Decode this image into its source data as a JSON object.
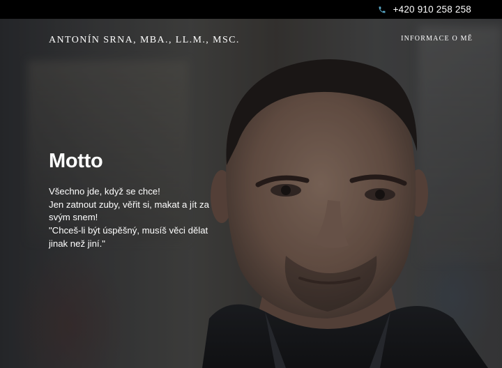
{
  "topbar": {
    "phone_icon": "phone-icon",
    "phone": "+420 910 258 258",
    "accent": "#5aa9c8"
  },
  "header": {
    "brand": "ANTONÍN SRNA, MBA., LL.M., MSC.",
    "nav_about": "INFORMACE O MĚ"
  },
  "hero": {
    "heading": "Motto",
    "lines": [
      "Všechno jde, když se chce!",
      "Jen zatnout zuby, věřit si, makat a jít za",
      "svým snem!",
      "\"Chceš-li být úspěšný, musíš věci dělat",
      "jinak než jiní.\""
    ]
  }
}
